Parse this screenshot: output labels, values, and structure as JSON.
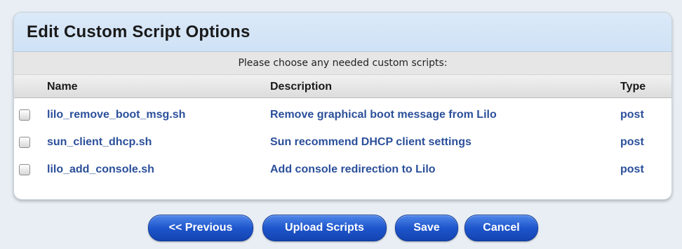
{
  "panel": {
    "title": "Edit Custom Script Options",
    "instructions": "Please choose any needed custom scripts:"
  },
  "table": {
    "headers": {
      "name": "Name",
      "description": "Description",
      "type": "Type"
    },
    "rows": [
      {
        "name": "lilo_remove_boot_msg.sh",
        "description": "Remove graphical boot message from Lilo",
        "type": "post",
        "checked": false
      },
      {
        "name": "sun_client_dhcp.sh",
        "description": "Sun recommend DHCP client settings",
        "type": "post",
        "checked": false
      },
      {
        "name": "lilo_add_console.sh",
        "description": "Add console redirection to Lilo",
        "type": "post",
        "checked": false
      }
    ]
  },
  "buttons": {
    "previous": "<< Previous",
    "upload": "Upload Scripts",
    "save": "Save",
    "cancel": "Cancel"
  },
  "colors": {
    "header_bg": "#cfe2f6",
    "link_text": "#2b4f9a",
    "button_blue": "#1f56cc"
  }
}
